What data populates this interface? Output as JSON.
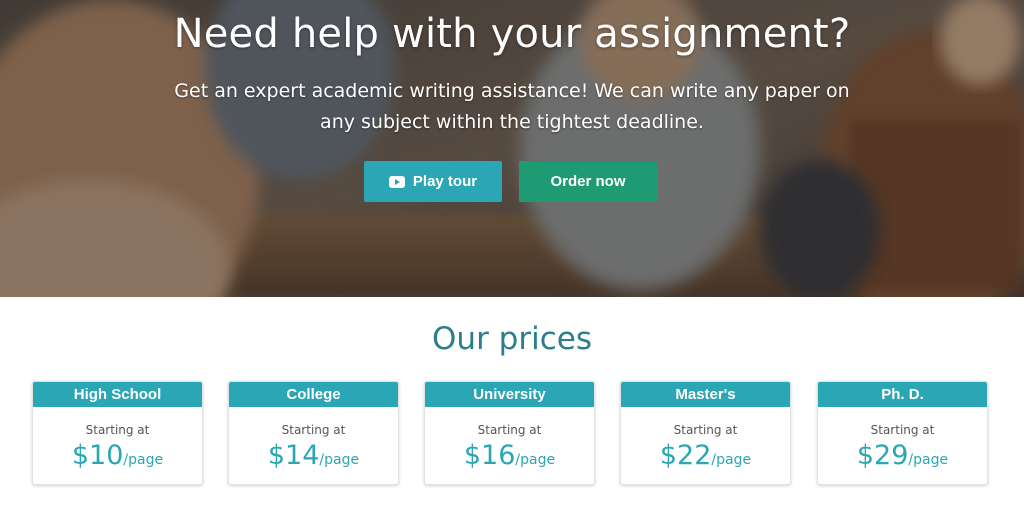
{
  "hero": {
    "title": "Need help with your assignment?",
    "subtitle": "Get an expert academic writing assistance! We can write any paper on any subject within the tightest deadline.",
    "buttons": {
      "play_tour": "Play tour",
      "order_now": "Order now"
    }
  },
  "prices": {
    "title": "Our prices",
    "cards": [
      {
        "level": "High School",
        "starting": "Starting at",
        "price": "$10",
        "unit": "/page"
      },
      {
        "level": "College",
        "starting": "Starting at",
        "price": "$14",
        "unit": "/page"
      },
      {
        "level": "University",
        "starting": "Starting at",
        "price": "$16",
        "unit": "/page"
      },
      {
        "level": "Master's",
        "starting": "Starting at",
        "price": "$22",
        "unit": "/page"
      },
      {
        "level": "Ph. D.",
        "starting": "Starting at",
        "price": "$29",
        "unit": "/page"
      }
    ]
  },
  "colors": {
    "accent_teal": "#2ba6b5",
    "accent_green": "#1f9b74",
    "title_teal": "#2c7f8a"
  }
}
